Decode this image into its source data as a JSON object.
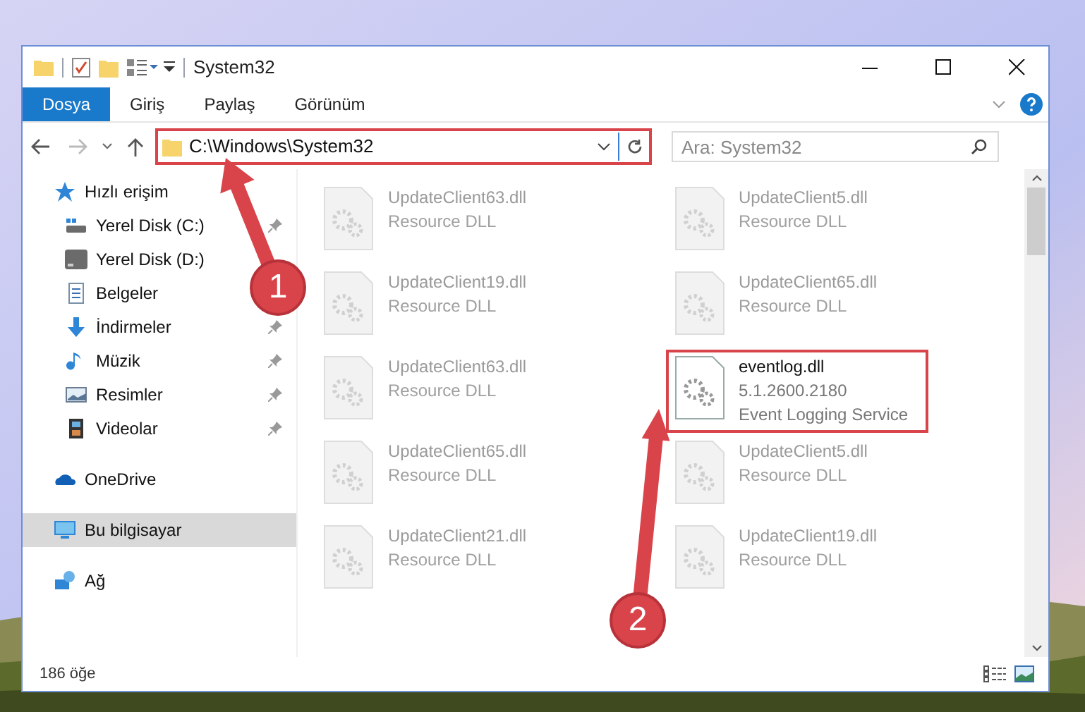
{
  "window": {
    "title": "System32"
  },
  "ribbon_tabs": [
    {
      "label": "Dosya",
      "selected": true
    },
    {
      "label": "Giriş",
      "selected": false
    },
    {
      "label": "Paylaş",
      "selected": false
    },
    {
      "label": "Görünüm",
      "selected": false
    }
  ],
  "address_bar": {
    "path": "C:\\Windows\\System32"
  },
  "search": {
    "placeholder": "Ara: System32"
  },
  "sidebar": {
    "items": [
      {
        "label": "Hızlı erişim",
        "selected": false,
        "children": [
          {
            "label": "Yerel Disk (C:)",
            "pinned": true,
            "selected": false
          },
          {
            "label": "Yerel Disk (D:)",
            "pinned": false,
            "selected": false
          },
          {
            "label": "Belgeler",
            "pinned": false,
            "selected": false
          },
          {
            "label": "İndirmeler",
            "pinned": true,
            "selected": false
          },
          {
            "label": "Müzik",
            "pinned": true,
            "selected": false
          },
          {
            "label": "Resimler",
            "pinned": true,
            "selected": false
          },
          {
            "label": "Videolar",
            "pinned": true,
            "selected": false
          }
        ]
      },
      {
        "label": "OneDrive",
        "selected": false
      },
      {
        "label": "Bu bilgisayar",
        "selected": true
      },
      {
        "label": "Ağ",
        "selected": false
      }
    ]
  },
  "files": [
    {
      "name": "UpdateClient63.dll",
      "lines": [
        "Resource DLL"
      ],
      "highlighted": false
    },
    {
      "name": "UpdateClient5.dll",
      "lines": [
        "Resource DLL"
      ],
      "highlighted": false
    },
    {
      "name": "UpdateClient19.dll",
      "lines": [
        "Resource DLL"
      ],
      "highlighted": false
    },
    {
      "name": "UpdateClient65.dll",
      "lines": [
        "Resource DLL"
      ],
      "highlighted": false
    },
    {
      "name": "UpdateClient63.dll",
      "lines": [
        "Resource DLL"
      ],
      "highlighted": false
    },
    {
      "name": "eventlog.dll",
      "lines": [
        "5.1.2600.2180",
        "Event Logging Service"
      ],
      "highlighted": true
    },
    {
      "name": "UpdateClient65.dll",
      "lines": [
        "Resource DLL"
      ],
      "highlighted": false
    },
    {
      "name": "UpdateClient5.dll",
      "lines": [
        "Resource DLL"
      ],
      "highlighted": false
    },
    {
      "name": "UpdateClient21.dll",
      "lines": [
        "Resource DLL"
      ],
      "highlighted": false
    },
    {
      "name": "UpdateClient19.dll",
      "lines": [
        "Resource DLL"
      ],
      "highlighted": false
    }
  ],
  "status_bar": {
    "item_count": "186 öğe"
  },
  "annotations": [
    {
      "label": "1"
    },
    {
      "label": "2"
    }
  ]
}
